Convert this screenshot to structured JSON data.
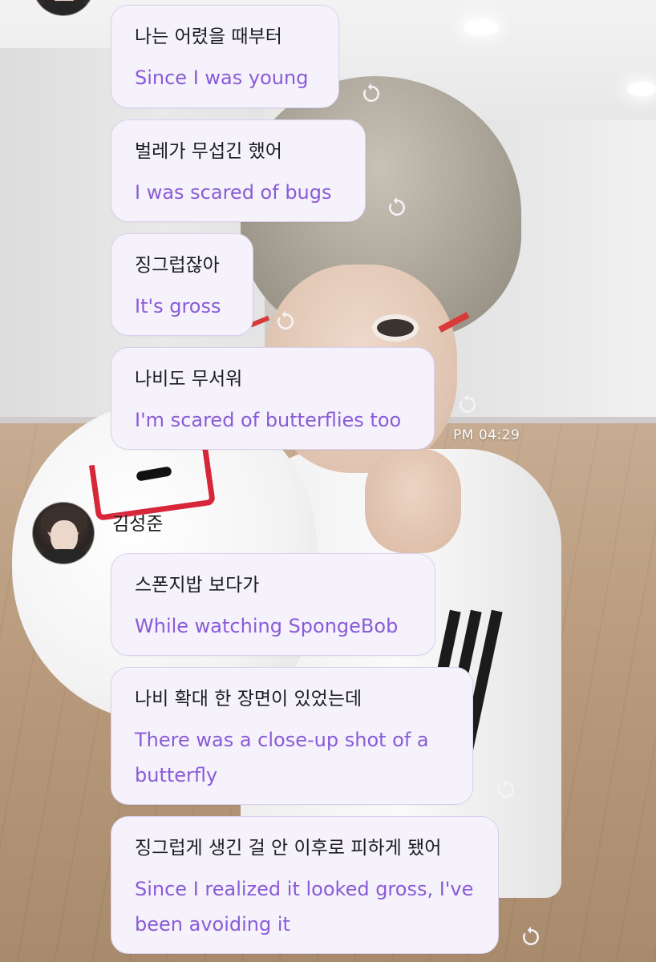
{
  "colors": {
    "bubble_bg": "#f5f2fb",
    "bubble_border": "#d9d0ee",
    "translation_text": "#8a5bd8",
    "original_text": "#1c1c1e",
    "timestamp_text": "#ffffff"
  },
  "icons": {
    "translate_retry": "refresh-icon",
    "profile_picture": "avatar"
  },
  "group1": {
    "messages": [
      {
        "original": "나는 어렸을 때부터",
        "translation": "Since I was young"
      },
      {
        "original": "벌레가 무섭긴 했어",
        "translation": "I was scared of bugs"
      },
      {
        "original": "징그럽잖아",
        "translation": "It's gross"
      },
      {
        "original": "나비도 무서워",
        "translation": "I'm scared of butterflies too"
      }
    ],
    "timestamp": "PM 04:29"
  },
  "group2": {
    "sender_name": "김성준",
    "messages": [
      {
        "original": "스폰지밥 보다가",
        "translation": "While watching SpongeBob"
      },
      {
        "original": "나비 확대 한 장면이 있었는데",
        "translation": "There was a close-up shot of a butterfly"
      },
      {
        "original": "징그럽게 생긴 걸 안 이후로 피하게 됐어",
        "translation": "Since I realized it looked gross, I've been avoiding it"
      }
    ]
  }
}
